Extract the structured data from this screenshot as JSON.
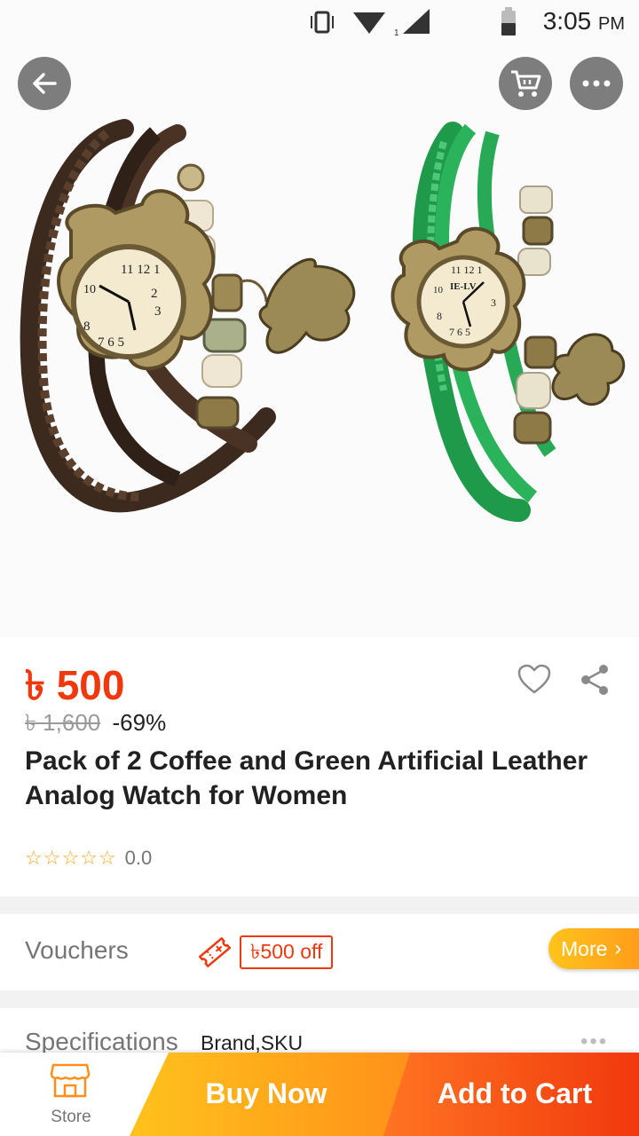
{
  "status_bar": {
    "time": "3:05",
    "ampm": "PM",
    "network_label": "1"
  },
  "top_actions": {
    "back_icon": "arrow-left-icon",
    "cart_icon": "cart-icon",
    "more_icon": "more-dots-icon"
  },
  "product": {
    "price": "৳ 500",
    "original_price": "৳ 1,600",
    "discount": "-69%",
    "title": "Pack of 2 Coffee and Green Artificial Leather Analog Watch for Women",
    "rating_value": "0.0",
    "rating_stars": 0,
    "watch_texts": [
      "12",
      "3",
      "6",
      "9",
      "IE-LV"
    ]
  },
  "vouchers": {
    "label": "Vouchers",
    "tag": "৳500 off",
    "more_label": "More"
  },
  "specifications": {
    "label": "Specifications",
    "value": "Brand,SKU"
  },
  "bottom_bar": {
    "store_label": "Store",
    "buy_now_label": "Buy Now",
    "add_to_cart_label": "Add to Cart"
  },
  "colors": {
    "accent": "#f1380d",
    "orange": "#ff8f1a",
    "yellow": "#ffc21c",
    "star": "#f5a623"
  }
}
